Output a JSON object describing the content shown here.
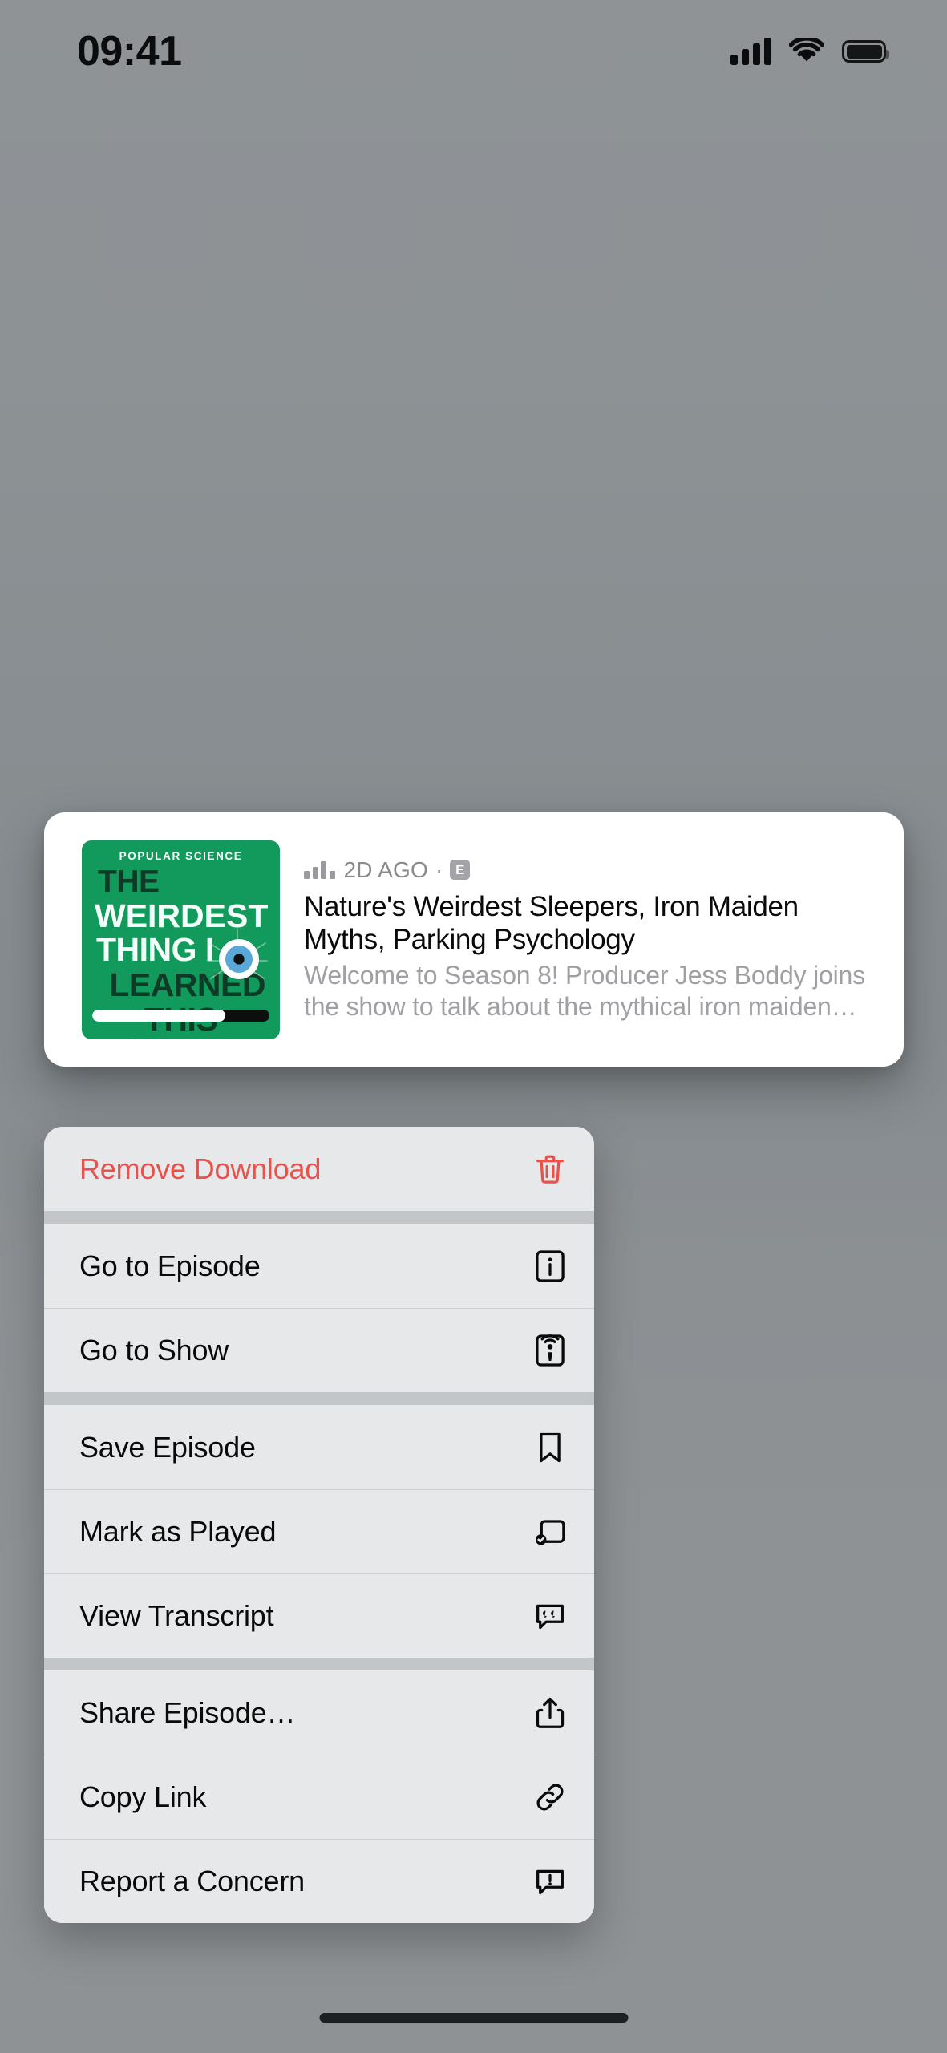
{
  "status_bar": {
    "time": "09:41",
    "signal_icon": "cellular-signal-icon",
    "wifi_icon": "wifi-icon",
    "battery_icon": "battery-full-icon"
  },
  "episode_card": {
    "artwork": {
      "name": "podcast-artwork",
      "brand": "POPULAR SCIENCE",
      "line1": "THE",
      "line2": "WEIRDEST",
      "line3": "THING I",
      "line4": "LEARNED",
      "line5": "THIS WEEK",
      "background_color": "#119a5b",
      "dark_text_color": "#0d3b27",
      "light_text_color": "#f2fff8",
      "progress_percent": 75,
      "eye_icon": "eyeball-icon"
    },
    "meta": {
      "waveform_icon": "now-playing-waveform-icon",
      "date": "2D AGO",
      "separator": "·",
      "explicit_badge": "E"
    },
    "title": "Nature's Weirdest Sleepers, Iron Maiden Myths, Parking Psychology",
    "description": "Welcome to Season 8! Producer Jess Boddy joins the show to talk about the mythical iron maiden…"
  },
  "context_menu": {
    "destructive_color": "#e8524a",
    "groups": [
      {
        "items": [
          {
            "label": "Remove Download",
            "icon": "trash-icon",
            "destructive": true
          }
        ]
      },
      {
        "items": [
          {
            "label": "Go to Episode",
            "icon": "info-square-icon",
            "destructive": false
          },
          {
            "label": "Go to Show",
            "icon": "podcast-square-icon",
            "destructive": false
          }
        ]
      },
      {
        "items": [
          {
            "label": "Save Episode",
            "icon": "bookmark-icon",
            "destructive": false
          },
          {
            "label": "Mark as Played",
            "icon": "mark-played-icon",
            "destructive": false
          },
          {
            "label": "View Transcript",
            "icon": "quote-bubble-icon",
            "destructive": false
          }
        ]
      },
      {
        "items": [
          {
            "label": "Share Episode…",
            "icon": "share-icon",
            "destructive": false
          },
          {
            "label": "Copy Link",
            "icon": "link-icon",
            "destructive": false
          },
          {
            "label": "Report a Concern",
            "icon": "exclamation-bubble-icon",
            "destructive": false
          }
        ]
      }
    ]
  },
  "home_indicator": "home-indicator"
}
